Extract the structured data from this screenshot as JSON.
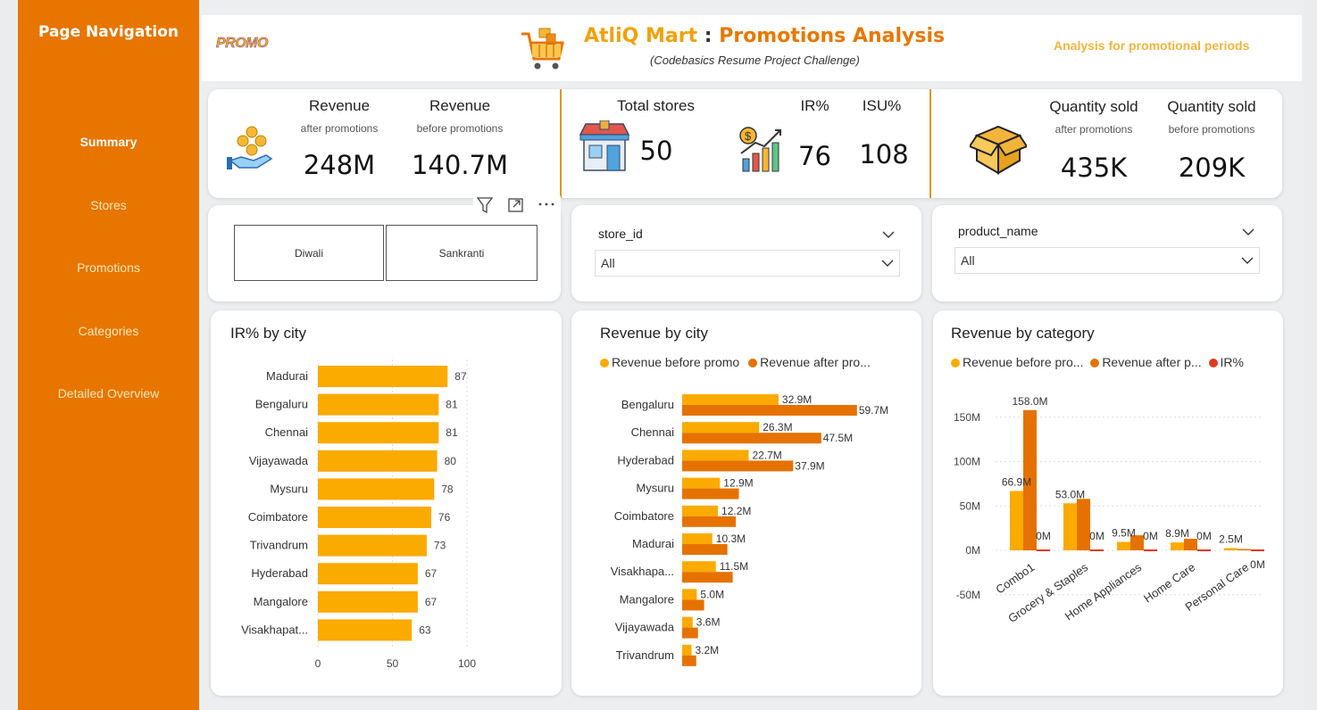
{
  "sidebar": {
    "title": "Page Navigation",
    "items": [
      {
        "label": "Summary",
        "active": true
      },
      {
        "label": "Stores",
        "active": false
      },
      {
        "label": "Promotions",
        "active": false
      },
      {
        "label": "Categories",
        "active": false
      },
      {
        "label": "Detailed Overview",
        "active": false
      }
    ]
  },
  "header": {
    "logo_text": "PROMO",
    "title_part1": "AtliQ Mart",
    "title_sep": " : ",
    "title_part2": "Promotions Analysis",
    "subtitle": "(Codebasics Resume Project Challenge)",
    "right_text": "Analysis for promotional periods"
  },
  "kpis": {
    "revenue_after": {
      "label": "Revenue",
      "sub": "after promotions",
      "value": "248M"
    },
    "revenue_before": {
      "label": "Revenue",
      "sub": "before promotions",
      "value": "140.7M"
    },
    "total_stores": {
      "label": "Total stores",
      "value": "50"
    },
    "ir": {
      "label": "IR%",
      "value": "76"
    },
    "isu": {
      "label": "ISU%",
      "value": "108"
    },
    "qty_after": {
      "label": "Quantity sold",
      "sub": "after promotions",
      "value": "435K"
    },
    "qty_before": {
      "label": "Quantity sold",
      "sub": "before promotions",
      "value": "209K"
    }
  },
  "filters": {
    "campaigns": [
      "Diwali",
      "Sankranti"
    ],
    "store_slicer": {
      "title": "store_id",
      "value": "All"
    },
    "product_slicer": {
      "title": "product_name",
      "value": "All"
    }
  },
  "colors": {
    "accent": "#e77500",
    "before": "#fbaa00",
    "after": "#e57200",
    "ir": "#e03a1e"
  },
  "charts": {
    "ir_title": "IR% by city",
    "rev_city_title": "Revenue by city",
    "rev_city_legend": [
      "Revenue before promo",
      "Revenue after pro..."
    ],
    "rev_cat_title": "Revenue by category",
    "rev_cat_legend": [
      "Revenue before pro...",
      "Revenue after p...",
      "IR%"
    ]
  },
  "chart_data": [
    {
      "type": "bar",
      "orientation": "horizontal",
      "title": "IR% by city",
      "categories": [
        "Madurai",
        "Bengaluru",
        "Chennai",
        "Vijayawada",
        "Mysuru",
        "Coimbatore",
        "Trivandrum",
        "Hyderabad",
        "Mangalore",
        "Visakhapat..."
      ],
      "values": [
        87,
        81,
        81,
        80,
        78,
        76,
        73,
        67,
        67,
        63
      ],
      "xlim": [
        0,
        100
      ],
      "xticks": [
        "0",
        "50",
        "100"
      ],
      "grid": true
    },
    {
      "type": "bar",
      "orientation": "horizontal",
      "title": "Revenue by city",
      "categories": [
        "Bengaluru",
        "Chennai",
        "Hyderabad",
        "Mysuru",
        "Coimbatore",
        "Madurai",
        "Visakhapa...",
        "Mangalore",
        "Vijayawada",
        "Trivandrum"
      ],
      "series": [
        {
          "name": "Revenue before promo",
          "values": [
            32.9,
            26.3,
            22.7,
            12.9,
            12.2,
            10.3,
            11.5,
            5.0,
            3.6,
            3.2
          ],
          "labels": [
            "32.9M",
            "26.3M",
            "22.7M",
            "12.9M",
            "12.2M",
            "10.3M",
            "11.5M",
            "5.0M",
            "3.6M",
            "3.2M"
          ]
        },
        {
          "name": "Revenue after pro...",
          "values": [
            59.7,
            47.5,
            37.9,
            0,
            0,
            0,
            0,
            0,
            0,
            0
          ],
          "labels": [
            "59.7M",
            "47.5M",
            "37.9M",
            "",
            "",
            "",
            "",
            "",
            "",
            ""
          ]
        }
      ],
      "legend": "top"
    },
    {
      "type": "bar",
      "title": "Revenue by category",
      "categories": [
        "Combo1",
        "Grocery & Staples",
        "Home Appliances",
        "Home Care",
        "Personal Care"
      ],
      "series": [
        {
          "name": "Revenue before pro...",
          "values": [
            66.9,
            53.0,
            9.5,
            8.9,
            2.5
          ],
          "labels": [
            "66.9M",
            "53.0M",
            "9.5M",
            "8.9M",
            "2.5M"
          ]
        },
        {
          "name": "Revenue after p...",
          "values": [
            158.0,
            58.0,
            17.0,
            13.0,
            1.5
          ],
          "labels": [
            "158.0M",
            "",
            "",
            "",
            ""
          ]
        },
        {
          "name": "IR%",
          "values": [
            0,
            0,
            0,
            0,
            0
          ],
          "labels": [
            "0M",
            "0M",
            "0M",
            "0M",
            "0M"
          ]
        }
      ],
      "ylim": [
        -50,
        160
      ],
      "yticks": [
        "150M",
        "100M",
        "50M",
        "0M",
        "-50M"
      ],
      "legend": "top"
    }
  ]
}
